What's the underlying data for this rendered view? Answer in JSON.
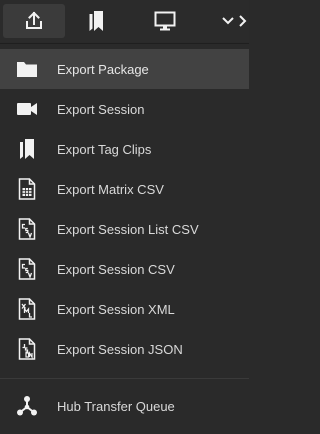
{
  "toolbar": {
    "buttons": [
      {
        "icon": "export-icon",
        "active": true
      },
      {
        "icon": "tag-clip-icon",
        "active": false
      },
      {
        "icon": "monitor-icon",
        "active": false
      },
      {
        "icon": "chevron-down-icon",
        "active": false
      }
    ]
  },
  "menu": {
    "items": [
      {
        "label": "Export Package",
        "icon": "folder-icon",
        "highlighted": true
      },
      {
        "label": "Export Session",
        "icon": "video-camera-icon",
        "highlighted": false
      },
      {
        "label": "Export Tag Clips",
        "icon": "tag-clip-icon",
        "highlighted": false
      },
      {
        "label": "Export Matrix CSV",
        "icon": "matrix-csv-file-icon",
        "highlighted": false
      },
      {
        "label": "Export Session List CSV",
        "icon": "csv-file-icon",
        "highlighted": false
      },
      {
        "label": "Export Session CSV",
        "icon": "csv-file-icon",
        "highlighted": false
      },
      {
        "label": "Export Session XML",
        "icon": "xml-file-icon",
        "highlighted": false
      },
      {
        "label": "Export Session JSON",
        "icon": "json-file-icon",
        "highlighted": false
      },
      {
        "label": "Hub Transfer Queue",
        "icon": "hub-network-icon",
        "highlighted": false
      }
    ]
  },
  "colors": {
    "background": "#2a2a2a",
    "highlight": "#424242",
    "active_button": "#3b3b3b",
    "icon": "#f2f2f2",
    "text": "#d9d9d9"
  }
}
